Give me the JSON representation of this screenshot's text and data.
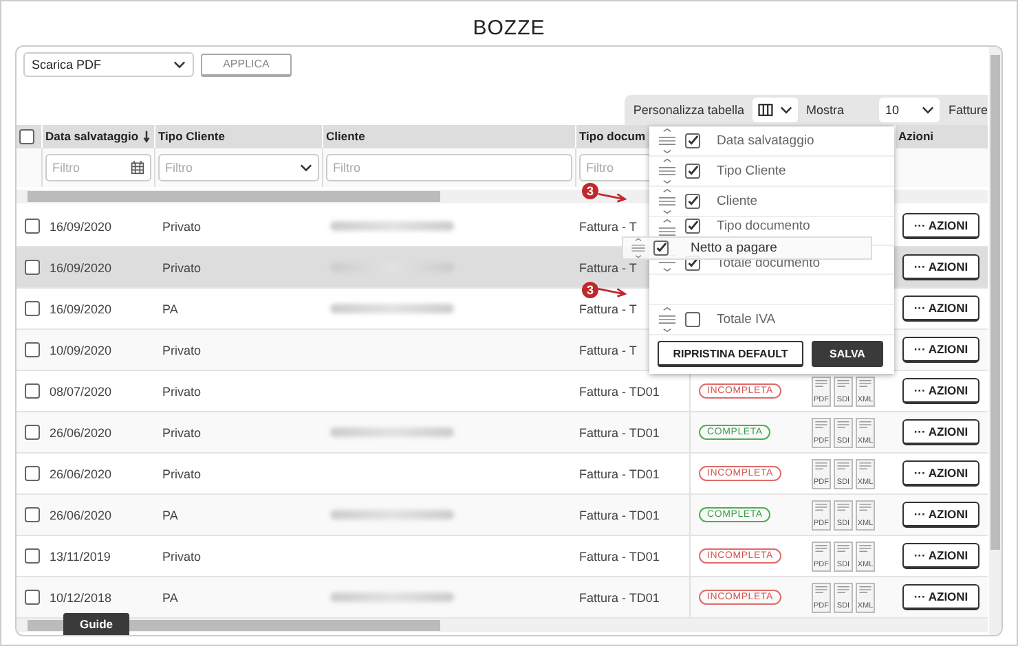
{
  "page_title": "BOZZE",
  "bulk": {
    "action": "Scarica PDF",
    "apply": "APPLICA"
  },
  "toolbar": {
    "customize_label": "Personalizza tabella",
    "show_label": "Mostra",
    "page_size": "10",
    "unit_label": "Fatture"
  },
  "table": {
    "select_all_checked": false,
    "columns": [
      {
        "label": "Data salvataggio",
        "sorted": true,
        "filter": {
          "kind": "date",
          "placeholder": "Filtro"
        }
      },
      {
        "label": "Tipo Cliente",
        "sorted": false,
        "filter": {
          "kind": "select",
          "placeholder": "Filtro"
        }
      },
      {
        "label": "Cliente",
        "sorted": false,
        "filter": {
          "kind": "text",
          "placeholder": "Filtro"
        }
      },
      {
        "label": "Tipo docum",
        "filter": {
          "kind": "text",
          "placeholder": "Filtro"
        }
      }
    ],
    "actions_header": "Azioni",
    "rows": [
      {
        "checked": false,
        "selected": false,
        "date": "16/09/2020",
        "client_type": "Privato",
        "client_redacted": true,
        "doc_type": "Fattura - T",
        "action": "··· AZIONI"
      },
      {
        "checked": false,
        "selected": true,
        "date": "16/09/2020",
        "client_type": "Privato",
        "client_redacted": true,
        "doc_type": "Fattura - T",
        "action": "··· AZIONI"
      },
      {
        "checked": false,
        "selected": false,
        "date": "16/09/2020",
        "client_type": "PA",
        "client_redacted": true,
        "doc_type": "Fattura - T",
        "action": "··· AZIONI"
      },
      {
        "checked": false,
        "selected": false,
        "date": "10/09/2020",
        "client_type": "Privato",
        "client_redacted": false,
        "doc_type": "Fattura - T",
        "action": "··· AZIONI"
      },
      {
        "checked": false,
        "selected": false,
        "date": "08/07/2020",
        "client_type": "Privato",
        "client_redacted": false,
        "doc_type": "Fattura - TD01",
        "status": {
          "label": "INCOMPLETA",
          "kind": "incomplete"
        },
        "files": [
          "PDF",
          "SDI",
          "XML"
        ],
        "action": "··· AZIONI"
      },
      {
        "checked": false,
        "selected": false,
        "date": "26/06/2020",
        "client_type": "Privato",
        "client_redacted": true,
        "doc_type": "Fattura - TD01",
        "status": {
          "label": "COMPLETA",
          "kind": "complete"
        },
        "files": [
          "PDF",
          "SDI",
          "XML"
        ],
        "action": "··· AZIONI"
      },
      {
        "checked": false,
        "selected": false,
        "date": "26/06/2020",
        "client_type": "Privato",
        "client_redacted": false,
        "doc_type": "Fattura - TD01",
        "status": {
          "label": "INCOMPLETA",
          "kind": "incomplete"
        },
        "files": [
          "PDF",
          "SDI",
          "XML"
        ],
        "action": "··· AZIONI"
      },
      {
        "checked": false,
        "selected": false,
        "date": "26/06/2020",
        "client_type": "PA",
        "client_redacted": true,
        "doc_type": "Fattura - TD01",
        "status": {
          "label": "COMPLETA",
          "kind": "complete"
        },
        "files": [
          "PDF",
          "SDI",
          "XML"
        ],
        "action": "··· AZIONI"
      },
      {
        "checked": false,
        "selected": false,
        "date": "13/11/2019",
        "client_type": "Privato",
        "client_redacted": false,
        "doc_type": "Fattura - TD01",
        "status": {
          "label": "INCOMPLETA",
          "kind": "incomplete"
        },
        "files": [
          "PDF",
          "SDI",
          "XML"
        ],
        "action": "··· AZIONI"
      },
      {
        "checked": false,
        "selected": false,
        "date": "10/12/2018",
        "client_type": "PA",
        "client_redacted": true,
        "doc_type": "Fattura - TD01",
        "status": {
          "label": "INCOMPLETA",
          "kind": "incomplete"
        },
        "files": [
          "PDF",
          "SDI",
          "XML"
        ],
        "action": "··· AZIONI"
      }
    ]
  },
  "column_menu": {
    "items": [
      {
        "kind": "item",
        "label": "Data salvataggio",
        "checked": true
      },
      {
        "kind": "item",
        "label": "Tipo Cliente",
        "checked": true
      },
      {
        "kind": "item",
        "label": "Cliente",
        "checked": true
      },
      {
        "kind": "item",
        "label": "Tipo documento",
        "checked": true
      },
      {
        "kind": "item",
        "label": "Totale documento",
        "checked": true
      },
      {
        "kind": "gap"
      },
      {
        "kind": "item",
        "label": "Totale IVA",
        "checked": false
      }
    ],
    "dragging": {
      "label": "Netto a pagare",
      "checked": true
    },
    "reset": "RIPRISTINA DEFAULT",
    "save": "SALVA"
  },
  "callouts": [
    {
      "label": "3"
    },
    {
      "label": "3"
    }
  ],
  "guide_tab": "Guide"
}
